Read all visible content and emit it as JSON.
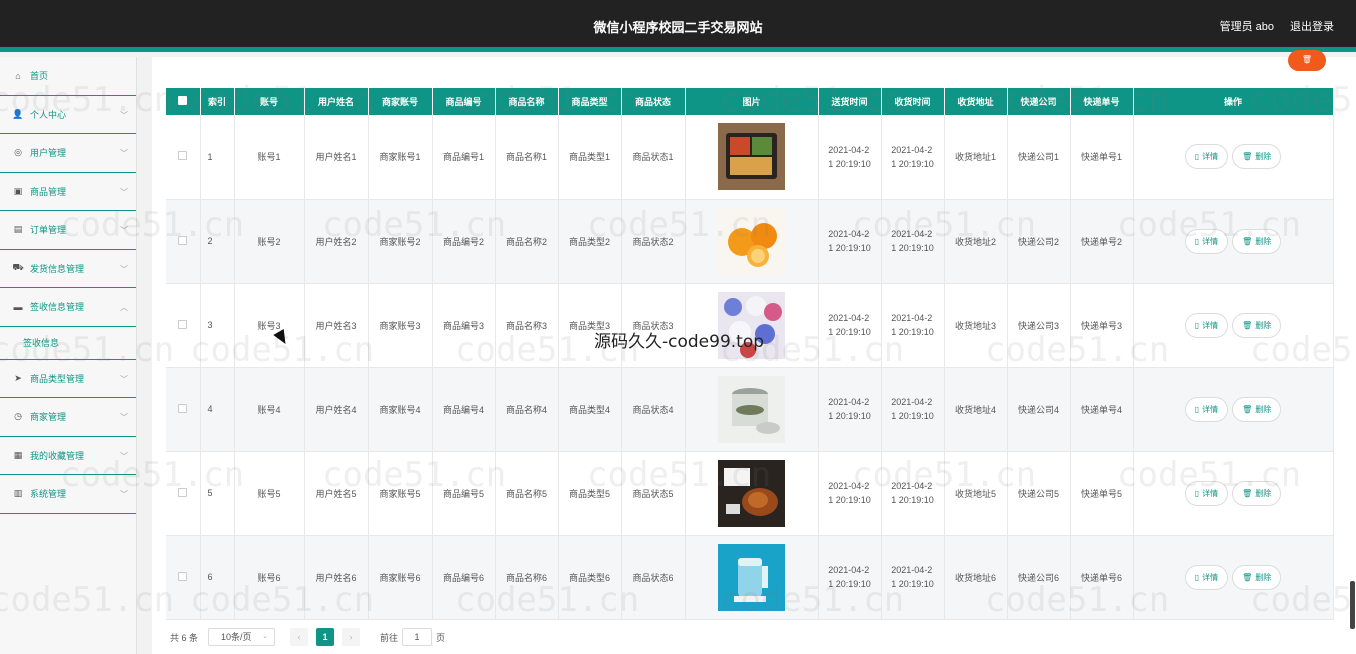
{
  "header": {
    "title": "微信小程序校园二手交易网站",
    "admin_label": "管理员 abo",
    "logout_label": "退出登录"
  },
  "sidebar": {
    "items": [
      {
        "label": "首页",
        "icon": "home-icon",
        "chevron": false
      },
      {
        "label": "个人中心",
        "icon": "user-icon",
        "chevron": true
      },
      {
        "label": "用户管理",
        "icon": "user-circle-icon",
        "chevron": true
      },
      {
        "label": "商品管理",
        "icon": "bag-icon",
        "chevron": true
      },
      {
        "label": "订单管理",
        "icon": "order-icon",
        "chevron": true
      },
      {
        "label": "发货信息管理",
        "icon": "ship-icon",
        "chevron": true
      },
      {
        "label": "签收信息管理",
        "icon": "sign-icon",
        "chevron": true,
        "expanded": true
      },
      {
        "label": "商品类型管理",
        "icon": "send-icon",
        "chevron": true
      },
      {
        "label": "商家管理",
        "icon": "clock-icon",
        "chevron": true
      },
      {
        "label": "我的收藏管理",
        "icon": "star-icon",
        "chevron": true
      },
      {
        "label": "系统管理",
        "icon": "settings-icon",
        "chevron": true
      }
    ],
    "submenu_label": "签收信息"
  },
  "table": {
    "columns": [
      "索引",
      "账号",
      "用户姓名",
      "商家账号",
      "商品编号",
      "商品名称",
      "商品类型",
      "商品状态",
      "图片",
      "送货时间",
      "收货时间",
      "收货地址",
      "快递公司",
      "快递单号",
      "操作"
    ],
    "detail_label": "详情",
    "delete_label": "删除",
    "rows": [
      {
        "index": "1",
        "account": "账号1",
        "username": "用户姓名1",
        "merchant": "商家账号1",
        "goods_no": "商品编号1",
        "goods_name": "商品名称1",
        "goods_type": "商品类型1",
        "status": "商品状态1",
        "image": "food-box",
        "ship_time_a": "2021-04-2",
        "ship_time_b": "1 20:19:10",
        "recv_time_a": "2021-04-2",
        "recv_time_b": "1 20:19:10",
        "address": "收货地址1",
        "courier": "快递公司1",
        "tracking": "快递单号1"
      },
      {
        "index": "2",
        "account": "账号2",
        "username": "用户姓名2",
        "merchant": "商家账号2",
        "goods_no": "商品编号2",
        "goods_name": "商品名称2",
        "goods_type": "商品类型2",
        "status": "商品状态2",
        "image": "oranges",
        "ship_time_a": "2021-04-2",
        "ship_time_b": "1 20:19:10",
        "recv_time_a": "2021-04-2",
        "recv_time_b": "1 20:19:10",
        "address": "收货地址2",
        "courier": "快递公司2",
        "tracking": "快递单号2"
      },
      {
        "index": "3",
        "account": "账号3",
        "username": "用户姓名3",
        "merchant": "商家账号3",
        "goods_no": "商品编号3",
        "goods_name": "商品名称3",
        "goods_type": "商品类型3",
        "status": "商品状态3",
        "image": "candy",
        "ship_time_a": "2021-04-2",
        "ship_time_b": "1 20:19:10",
        "recv_time_a": "2021-04-2",
        "recv_time_b": "1 20:19:10",
        "address": "收货地址3",
        "courier": "快递公司3",
        "tracking": "快递单号3"
      },
      {
        "index": "4",
        "account": "账号4",
        "username": "用户姓名4",
        "merchant": "商家账号4",
        "goods_no": "商品编号4",
        "goods_name": "商品名称4",
        "goods_type": "商品类型4",
        "status": "商品状态4",
        "image": "jar",
        "ship_time_a": "2021-04-2",
        "ship_time_b": "1 20:19:10",
        "recv_time_a": "2021-04-2",
        "recv_time_b": "1 20:19:10",
        "address": "收货地址4",
        "courier": "快递公司4",
        "tracking": "快递单号4"
      },
      {
        "index": "5",
        "account": "账号5",
        "username": "用户姓名5",
        "merchant": "商家账号5",
        "goods_no": "商品编号5",
        "goods_name": "商品名称5",
        "goods_type": "商品类型5",
        "status": "商品状态5",
        "image": "meat",
        "ship_time_a": "2021-04-2",
        "ship_time_b": "1 20:19:10",
        "recv_time_a": "2021-04-2",
        "recv_time_b": "1 20:19:10",
        "address": "收货地址5",
        "courier": "快递公司5",
        "tracking": "快递单号5"
      },
      {
        "index": "6",
        "account": "账号6",
        "username": "用户姓名6",
        "merchant": "商家账号6",
        "goods_no": "商品编号6",
        "goods_name": "商品名称6",
        "goods_type": "商品类型6",
        "status": "商品状态6",
        "image": "kettle",
        "ship_time_a": "2021-04-2",
        "ship_time_b": "1 20:19:10",
        "recv_time_a": "2021-04-2",
        "recv_time_b": "1 20:19:10",
        "address": "收货地址6",
        "courier": "快递公司6",
        "tracking": "快递单号6"
      }
    ]
  },
  "pagination": {
    "total_label": "共 6 条",
    "page_size": "10条/页",
    "prev": "‹",
    "next": "›",
    "current_page": "1",
    "goto_label": "前往",
    "goto_value": "1",
    "page_suffix": "页"
  },
  "overlay_text": "源码久久-code99.top",
  "watermark_text": "code51.cn",
  "colors": {
    "accent": "#0f9585",
    "header_bg": "#222222",
    "fab": "#f05a1a"
  }
}
